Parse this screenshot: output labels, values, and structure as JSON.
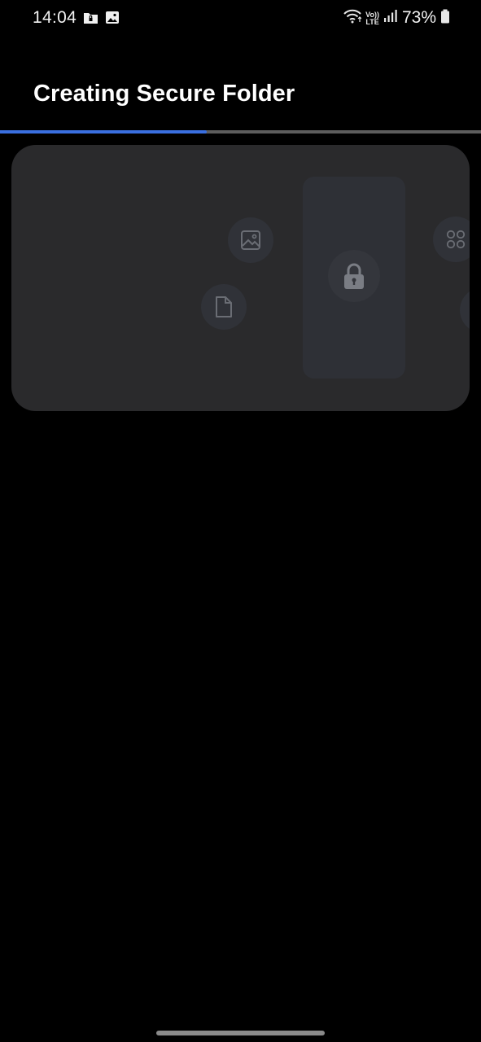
{
  "status_bar": {
    "time": "14:04",
    "left_icons": [
      "secure-folder-icon",
      "image-icon"
    ],
    "right_icons": [
      "wifi-icon",
      "volte-icon",
      "signal-icon",
      "battery-icon"
    ],
    "volte_top": "Vo))",
    "volte_bottom": "LTE",
    "battery_percent": "73%"
  },
  "header": {
    "title": "Creating Secure Folder"
  },
  "progress": {
    "fraction": 0.43,
    "fill_color": "#3a6fe0",
    "track_color": "#5d5d5d"
  },
  "illustration": {
    "icons": [
      "image-icon",
      "file-icon",
      "lock-icon",
      "apps-grid-icon"
    ]
  },
  "colors": {
    "background": "#000000",
    "card": "#2a2a2c"
  }
}
